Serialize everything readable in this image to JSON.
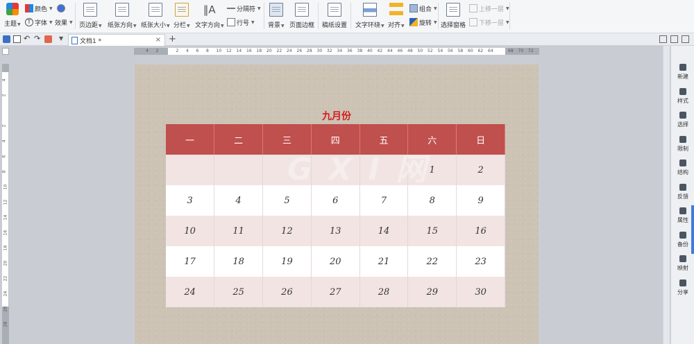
{
  "ribbon": {
    "theme": "主题",
    "color": "颜色",
    "font": "字体",
    "effect": "效果",
    "margin": "页边距",
    "orientation": "纸张方向",
    "size": "纸张大小",
    "columns": "分栏",
    "text_direction": "文字方向",
    "separator": "分隔符",
    "line_number": "行号",
    "background": "背景",
    "page_border": "页面边框",
    "manuscript": "稿纸设置",
    "wrap_text": "文字环绕",
    "align": "对齐",
    "group": "组合",
    "rotate": "旋转",
    "selection_pane": "选择窗格",
    "move_up": "上移一层",
    "move_down": "下移一层"
  },
  "tabbar": {
    "doc_tab": "文档1 *"
  },
  "ruler": {
    "h_ticks": [
      "4",
      "2",
      "",
      "2",
      "4",
      "6",
      "8",
      "10",
      "12",
      "14",
      "16",
      "18",
      "20",
      "22",
      "24",
      "26",
      "28",
      "30",
      "32",
      "34",
      "36",
      "38",
      "40",
      "42",
      "44",
      "46",
      "48",
      "50",
      "52",
      "54",
      "56",
      "58",
      "60",
      "62",
      "64",
      "",
      "68",
      "70",
      "72"
    ],
    "v_ticks": [
      "4",
      "2",
      "",
      "2",
      "4",
      "6",
      "8",
      "10",
      "12",
      "14",
      "16",
      "18",
      "20",
      "22",
      "24",
      "26",
      "28"
    ]
  },
  "calendar": {
    "title": "九月份",
    "headers": [
      "一",
      "二",
      "三",
      "四",
      "五",
      "六",
      "日"
    ],
    "rows": [
      [
        "",
        "",
        "",
        "",
        "",
        "1",
        "2"
      ],
      [
        "3",
        "4",
        "5",
        "6",
        "7",
        "8",
        "9"
      ],
      [
        "10",
        "11",
        "12",
        "13",
        "14",
        "15",
        "16"
      ],
      [
        "17",
        "18",
        "19",
        "20",
        "21",
        "22",
        "23"
      ],
      [
        "24",
        "25",
        "26",
        "27",
        "28",
        "29",
        "30"
      ]
    ],
    "header_color": "#c0504d",
    "title_color": "#d41c1c",
    "alt_row_color": "#f1e4e3"
  },
  "watermark": "G X I 网",
  "sidebar": {
    "items": [
      "新建",
      "样式",
      "选择",
      "限制",
      "结构",
      "反馈",
      "属性",
      "备份",
      "映射",
      "分享"
    ]
  }
}
